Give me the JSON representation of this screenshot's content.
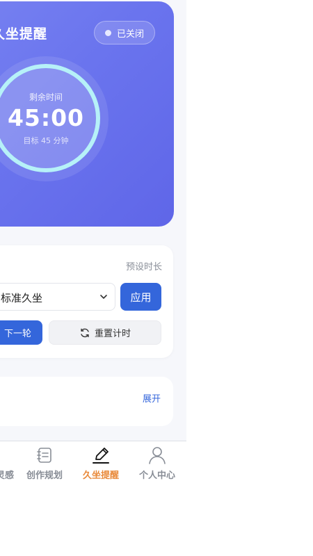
{
  "hero": {
    "title": "久坐提醒",
    "status": "已关闭",
    "remaining_label": "剩余时间",
    "time": "45:00",
    "goal": "目标 45 分钟"
  },
  "preset": {
    "label": "预设时长",
    "selected": "标准久坐",
    "apply_label": "应用",
    "next_label": "下一轮",
    "reset_label": "重置计时"
  },
  "collapse": {
    "expand_label": "展开"
  },
  "tabbar": {
    "items": [
      {
        "label": "灵感",
        "icon": "inspiration-icon",
        "active": false
      },
      {
        "label": "创作规划",
        "icon": "notebook-icon",
        "active": false
      },
      {
        "label": "久坐提醒",
        "icon": "pen-icon",
        "active": true
      },
      {
        "label": "个人中心",
        "icon": "user-icon",
        "active": false
      }
    ]
  },
  "colors": {
    "primary": "#3466db",
    "active_tab": "#e98a3b",
    "ring": "#b6f1f8"
  }
}
